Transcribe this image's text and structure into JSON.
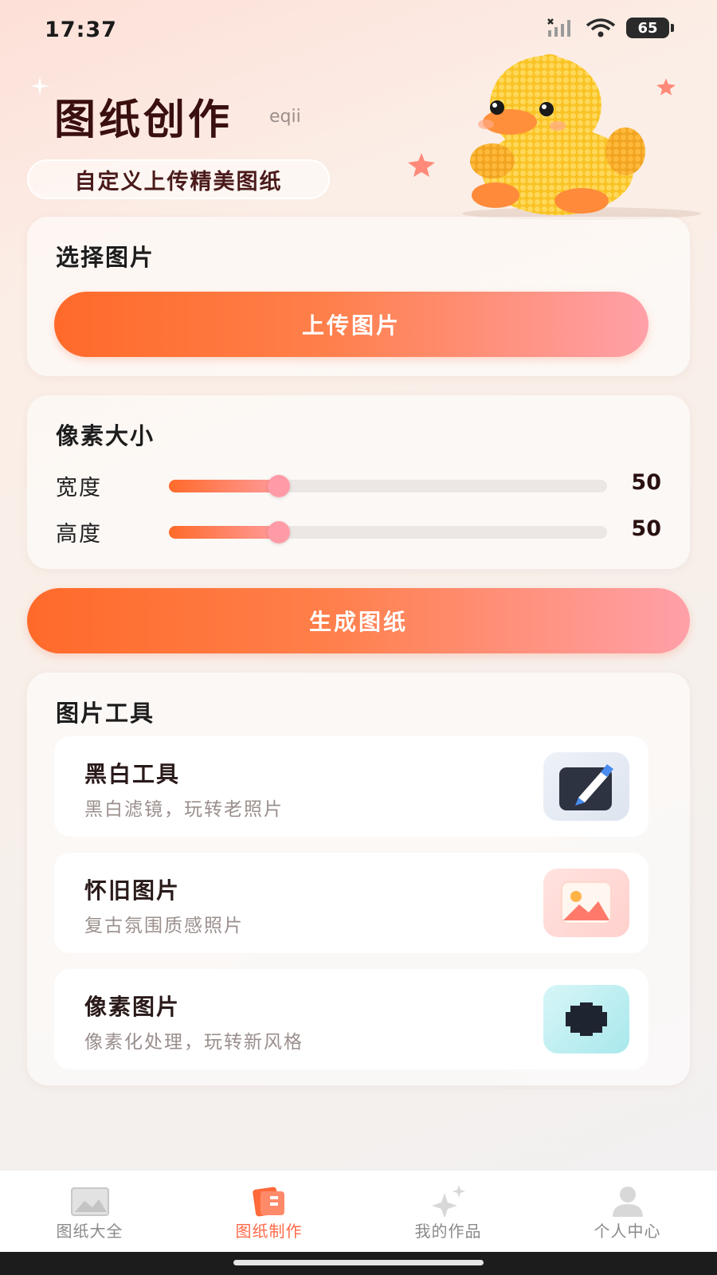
{
  "status_bar": {
    "time": "17:37",
    "battery": "65"
  },
  "hero": {
    "title": "图纸创作",
    "subtitle": "eqii",
    "tagline": "自定义上传精美图纸"
  },
  "select_image": {
    "title": "选择图片",
    "upload_label": "上传图片"
  },
  "pixel_size": {
    "title": "像素大小",
    "width": {
      "label": "宽度",
      "value": "50",
      "fraction": 0.25
    },
    "height": {
      "label": "高度",
      "value": "50",
      "fraction": 0.25
    }
  },
  "generate_label": "生成图纸",
  "tools": {
    "title": "图片工具",
    "items": [
      {
        "name": "黑白工具",
        "desc": "黑白滤镜，玩转老照片",
        "icon": "brush-icon"
      },
      {
        "name": "怀旧图片",
        "desc": "复古氛围质感照片",
        "icon": "picture-icon"
      },
      {
        "name": "像素图片",
        "desc": "像素化处理，玩转新风格",
        "icon": "chip-icon"
      }
    ]
  },
  "tabbar": {
    "items": [
      {
        "label": "图纸大全",
        "icon": "gallery-icon"
      },
      {
        "label": "图纸制作",
        "icon": "create-icon",
        "active": true
      },
      {
        "label": "我的作品",
        "icon": "sparkle-icon"
      },
      {
        "label": "个人中心",
        "icon": "user-icon"
      }
    ]
  },
  "colors": {
    "accent_start": "#ff6a2a",
    "accent_end": "#ffa0a8",
    "active_tab": "#ff6a4a"
  }
}
